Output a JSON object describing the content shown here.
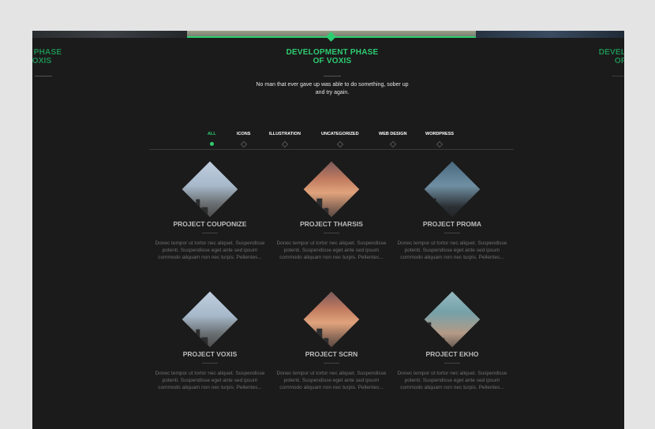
{
  "slider": {
    "left_title": "Development Phase\nof Voxis",
    "center_title": "Development Phase of Voxis",
    "right_title": "Development Phase of Voxis",
    "subtitle": "No man that ever gave up was able to do something, sober up and try again."
  },
  "filters": [
    {
      "label": "ALL",
      "active": true
    },
    {
      "label": "ICONS",
      "active": false
    },
    {
      "label": "ILLUSTRATION",
      "active": false
    },
    {
      "label": "UNCATEGORIZED",
      "active": false
    },
    {
      "label": "WEB DESIGN",
      "active": false
    },
    {
      "label": "WORDPRESS",
      "active": false
    }
  ],
  "projects": [
    {
      "title": "PROJECT COUPONIZE",
      "desc": "Donec tempor ut tortor nec aliquet. Suspendisse potenti. Suspendisse eget ante sed ipsum commodo aliquam non nec turpis. Pellentes...",
      "image": "city"
    },
    {
      "title": "PROJECT THARSIS",
      "desc": "Donec tempor ut tortor nec aliquet. Suspendisse potenti. Suspendisse eget ante sed ipsum commodo aliquam non nec turpis. Pellentes...",
      "image": "sunset"
    },
    {
      "title": "PROJECT PROMA",
      "desc": "Donec tempor ut tortor nec aliquet. Suspendisse potenti. Suspendisse eget ante sed ipsum commodo aliquam non nec turpis. Pellentes...",
      "image": "scope"
    },
    {
      "title": "PROJECT VOXIS",
      "desc": "Donec tempor ut tortor nec aliquet. Suspendisse potenti. Suspendisse eget ante sed ipsum commodo aliquam non nec turpis. Pellentes...",
      "image": "city"
    },
    {
      "title": "PROJECT SCRN",
      "desc": "Donec tempor ut tortor nec aliquet. Suspendisse potenti. Suspendisse eget ante sed ipsum commodo aliquam non nec turpis. Pellentes...",
      "image": "sunset"
    },
    {
      "title": "PROJECT EKHO",
      "desc": "Donec tempor ut tortor nec aliquet. Suspendisse potenti. Suspendisse eget ante sed ipsum commodo aliquam non nec turpis. Pellentes...",
      "image": "teal"
    }
  ],
  "colors": {
    "accent": "#2ecc71",
    "background": "#1b1b1b",
    "page": "#e4e4e4"
  }
}
